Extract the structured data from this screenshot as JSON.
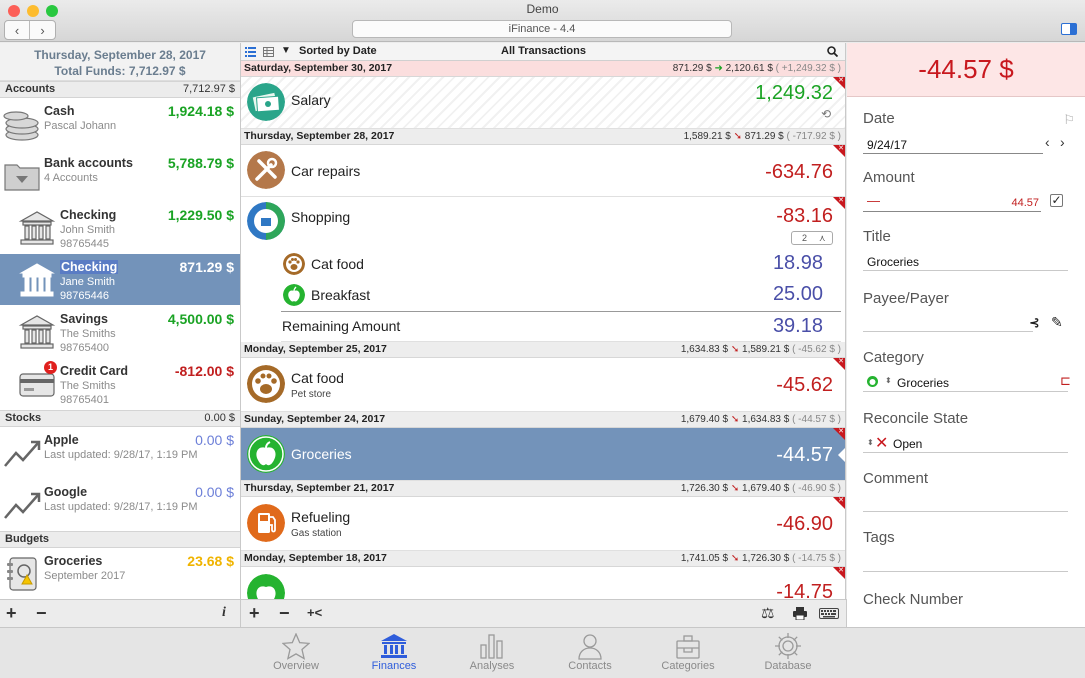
{
  "window": {
    "title": "Demo",
    "app_title": "iFinance - 4.4"
  },
  "left": {
    "date": "Thursday, September 28, 2017",
    "total_funds": "Total Funds: 7,712.97 $",
    "sections": {
      "accounts": {
        "label": "Accounts",
        "total": "7,712.97 $"
      },
      "stocks": {
        "label": "Stocks",
        "total": "0.00 $"
      },
      "budgets": {
        "label": "Budgets"
      }
    },
    "accounts": [
      {
        "name": "Cash",
        "sub1": "Pascal Johann",
        "sub2": "",
        "amount": "1,924.18 $",
        "icon": "coins-icon"
      },
      {
        "name": "Bank accounts",
        "sub1": "4 Accounts",
        "sub2": "",
        "amount": "5,788.79 $",
        "icon": "folder-icon"
      },
      {
        "name": "Checking",
        "sub1": "John Smith",
        "sub2": "98765445",
        "amount": "1,229.50 $",
        "icon": "bank-icon"
      },
      {
        "name": "Checking",
        "sub1": "Jane Smith",
        "sub2": "98765446",
        "amount": "871.29 $",
        "icon": "bank-icon"
      },
      {
        "name": "Savings",
        "sub1": "The Smiths",
        "sub2": "98765400",
        "amount": "4,500.00 $",
        "icon": "bank-icon"
      },
      {
        "name": "Credit Card",
        "sub1": "The Smiths",
        "sub2": "98765401",
        "amount": "-812.00 $",
        "icon": "credit-card-icon",
        "badge": "1"
      }
    ],
    "stocks": [
      {
        "name": "Apple",
        "sub1": "Last updated: 9/28/17, 1:19 PM",
        "amount": "0.00 $"
      },
      {
        "name": "Google",
        "sub1": "Last updated: 9/28/17, 1:19 PM",
        "amount": "0.00 $"
      }
    ],
    "budgets": [
      {
        "name": "Groceries",
        "sub1": "September 2017",
        "amount": "23.68 $"
      }
    ],
    "bottom": {
      "add": "+",
      "remove": "−",
      "info": "i"
    }
  },
  "middle": {
    "sort_label": "Sorted by Date",
    "view_title": "All Transactions",
    "days": [
      {
        "date": "Saturday, September 30, 2017",
        "from": "871.29 $",
        "to": "2,120.61 $",
        "diff": "( +1,249.32 $ )"
      },
      {
        "date": "Thursday, September 28, 2017",
        "from": "1,589.21 $",
        "to": "871.29 $",
        "diff": "( -717.92 $ )"
      },
      {
        "date": "Monday, September 25, 2017",
        "from": "1,634.83 $",
        "to": "1,589.21 $",
        "diff": "( -45.62 $ )"
      },
      {
        "date": "Sunday, September 24, 2017",
        "from": "1,679.40 $",
        "to": "1,634.83 $",
        "diff": "( -44.57 $ )"
      },
      {
        "date": "Thursday, September 21, 2017",
        "from": "1,726.30 $",
        "to": "1,679.40 $",
        "diff": "( -46.90 $ )"
      },
      {
        "date": "Monday, September 18, 2017",
        "from": "1,741.05 $",
        "to": "1,726.30 $",
        "diff": "( -14.75 $ )"
      }
    ],
    "transactions": {
      "salary": {
        "title": "Salary",
        "amount": "1,249.32"
      },
      "car": {
        "title": "Car repairs",
        "amount": "-634.76"
      },
      "shopping": {
        "title": "Shopping",
        "amount": "-83.16",
        "split_count": "2"
      },
      "split1": {
        "title": "Cat food",
        "amount": "18.98"
      },
      "split2": {
        "title": "Breakfast",
        "amount": "25.00"
      },
      "remaining": {
        "title": "Remaining Amount",
        "amount": "39.18"
      },
      "catfood": {
        "title": "Cat food",
        "sub": "Pet store",
        "amount": "-45.62"
      },
      "groceries": {
        "title": "Groceries",
        "amount": "-44.57"
      },
      "refuel": {
        "title": "Refueling",
        "sub": "Gas station",
        "amount": "-46.90"
      },
      "partial": {
        "amount": "-14.75"
      }
    },
    "bottom": {
      "add": "+",
      "remove": "−",
      "split": "+<"
    }
  },
  "right": {
    "amount": "-44.57 $",
    "date_label": "Date",
    "date_value": "9/24/17",
    "amount_label": "Amount",
    "amount_sign": "—",
    "amount_value": "44.57",
    "title_label": "Title",
    "title_value": "Groceries",
    "payee_label": "Payee/Payer",
    "category_label": "Category",
    "category_value": "Groceries",
    "reconcile_label": "Reconcile State",
    "reconcile_value": "Open",
    "comment_label": "Comment",
    "tags_label": "Tags",
    "check_label": "Check Number"
  },
  "tabs": [
    {
      "label": "Overview",
      "icon": "star-icon"
    },
    {
      "label": "Finances",
      "icon": "bank-icon"
    },
    {
      "label": "Analyses",
      "icon": "bar-chart-icon"
    },
    {
      "label": "Contacts",
      "icon": "person-icon"
    },
    {
      "label": "Categories",
      "icon": "categories-icon"
    },
    {
      "label": "Database",
      "icon": "gear-icon"
    }
  ],
  "colors": {
    "positive": "#1aa324",
    "negative": "#c11f1f",
    "selection": "#7393ba",
    "accent": "#2f5ddb"
  }
}
